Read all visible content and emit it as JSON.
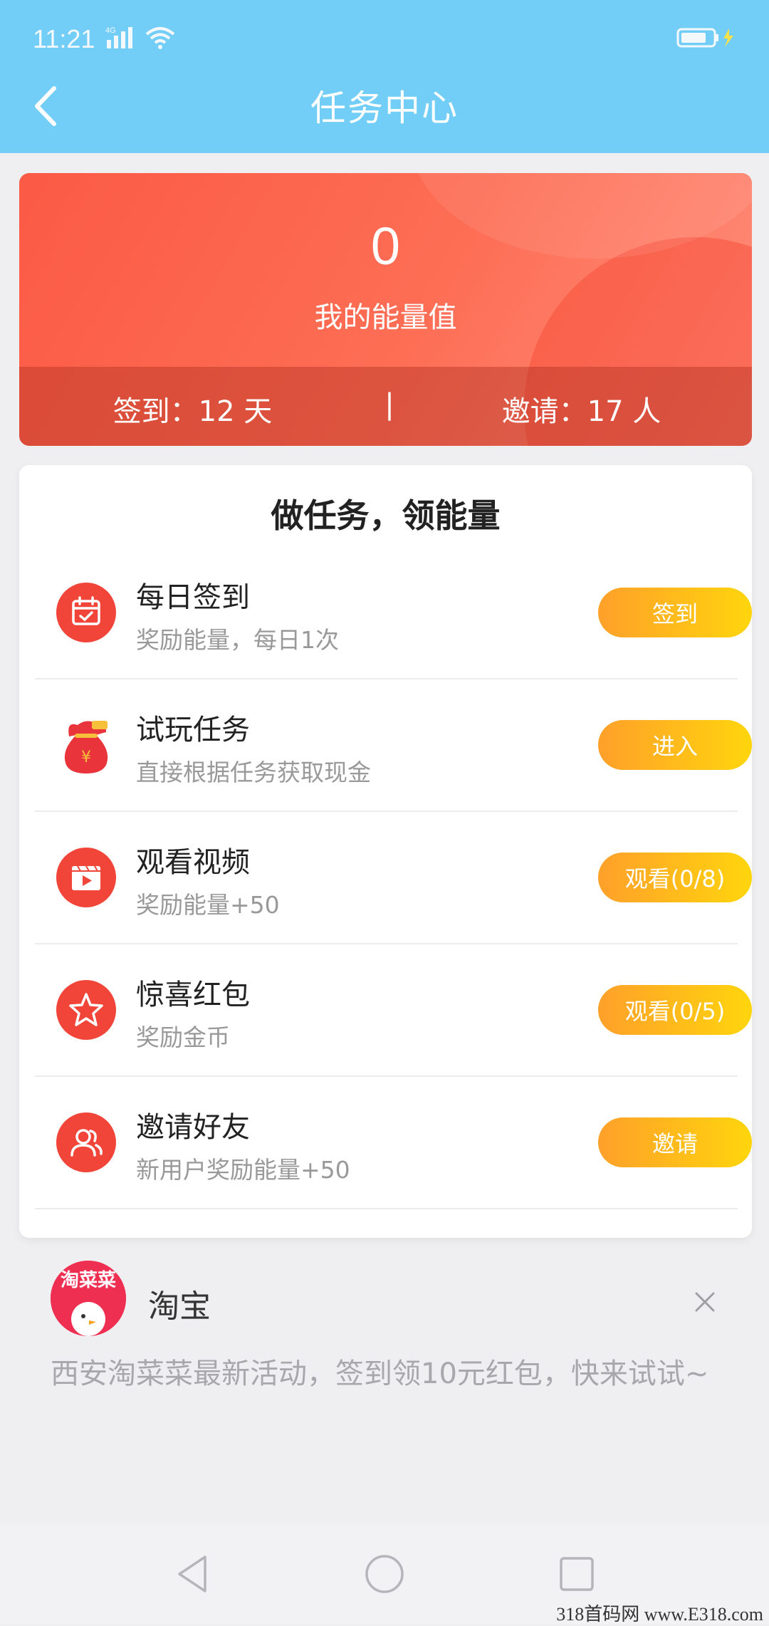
{
  "status_bar": {
    "time": "11:21",
    "network": "4G"
  },
  "header": {
    "title": "任务中心"
  },
  "energy": {
    "value": "0",
    "label": "我的能量值",
    "checkin_text": "签到：12 天",
    "separator": "|",
    "invite_text": "邀请：17 人"
  },
  "tasks": {
    "title": "做任务，领能量",
    "items": [
      {
        "title": "每日签到",
        "subtitle": "奖励能量，每日1次",
        "button": "签到",
        "icon": "calendar-icon"
      },
      {
        "title": "试玩任务",
        "subtitle": "直接根据任务获取现金",
        "button": "进入",
        "icon": "money-bag-icon"
      },
      {
        "title": "观看视频",
        "subtitle": "奖励能量+50",
        "button": "观看(0/8)",
        "icon": "video-icon"
      },
      {
        "title": "惊喜红包",
        "subtitle": "奖励金币",
        "button": "观看(0/5)",
        "icon": "star-icon"
      },
      {
        "title": "邀请好友",
        "subtitle": "新用户奖励能量+50",
        "button": "邀请",
        "icon": "users-icon"
      }
    ]
  },
  "notification": {
    "avatar_text": "淘菜菜",
    "app_name": "淘宝",
    "message": "西安淘菜菜最新活动，签到领10元红包，快来试试~"
  },
  "watermark": "318首码网 www.E318.com",
  "colors": {
    "header": "#72cef6",
    "energy_card": "#fb5a45",
    "button_start": "#ffa02a",
    "button_end": "#ffd50d",
    "task_icon": "#f2453a"
  }
}
